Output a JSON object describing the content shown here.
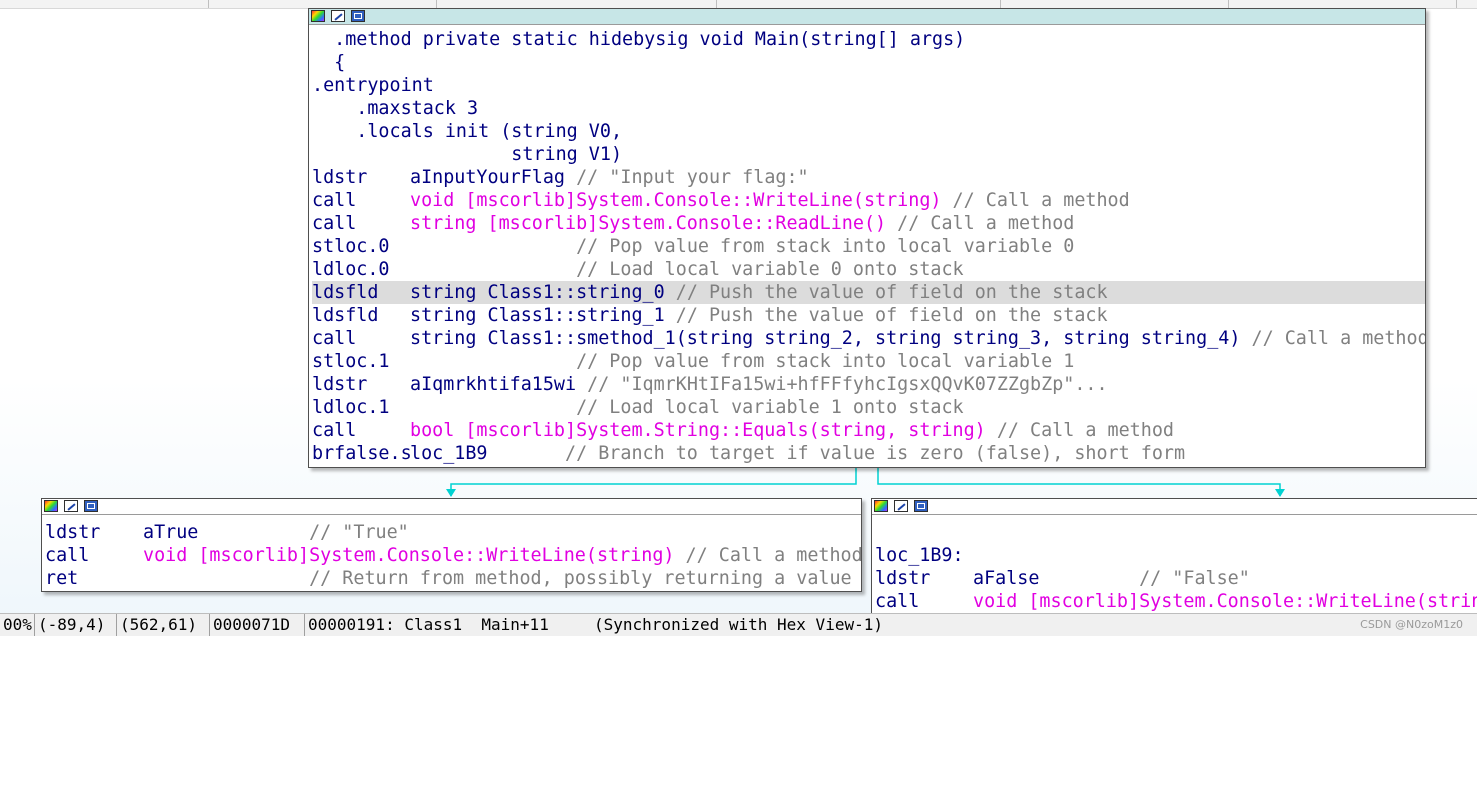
{
  "main_block": {
    "lines": [
      {
        "t": "  .method private static hidebysig void Main(string[] args)"
      },
      {
        "t": "  {"
      },
      {
        "t": ".entrypoint"
      },
      {
        "t": "    .maxstack 3"
      },
      {
        "t": "    .locals init (string V0,"
      },
      {
        "t": "                  string V1)"
      }
    ],
    "instructions": [
      {
        "mnemonic": "ldstr",
        "operand": "aInputYourFlag",
        "api": "",
        "comment": " // \"Input your flag:\"",
        "highlight": false
      },
      {
        "mnemonic": "call",
        "operand": "",
        "api": "void [mscorlib]System.Console::WriteLine(string)",
        "comment": " // Call a method",
        "highlight": false
      },
      {
        "mnemonic": "call",
        "operand": "",
        "api": "string [mscorlib]System.Console::ReadLine()",
        "comment": " // Call a method",
        "highlight": false
      },
      {
        "mnemonic": "stloc.0",
        "operand": "               ",
        "api": "",
        "comment": "// Pop value from stack into local variable 0",
        "highlight": false
      },
      {
        "mnemonic": "ldloc.0",
        "operand": "               ",
        "api": "",
        "comment": "// Load local variable 0 onto stack",
        "highlight": false
      },
      {
        "mnemonic": "ldsfld",
        "operand": "string Class1::string_0",
        "api": "",
        "comment": " // Push the value of field on the stack",
        "highlight": true
      },
      {
        "mnemonic": "ldsfld",
        "operand": "string Class1::string_1",
        "api": "",
        "comment": " // Push the value of field on the stack",
        "highlight": false
      },
      {
        "mnemonic": "call",
        "operand": "string Class1::smethod_1(string string_2, string string_3, string string_4)",
        "api": "",
        "comment": " // Call a method",
        "highlight": false
      },
      {
        "mnemonic": "stloc.1",
        "operand": "               ",
        "api": "",
        "comment": "// Pop value from stack into local variable 1",
        "highlight": false
      },
      {
        "mnemonic": "ldstr",
        "operand": "aIqmrkhtifa15wi",
        "api": "",
        "comment": " // \"IqmrKHtIFa15wi+hfFFfyhcIgsxQQvK07ZZgbZp\"...",
        "highlight": false
      },
      {
        "mnemonic": "ldloc.1",
        "operand": "               ",
        "api": "",
        "comment": "// Load local variable 1 onto stack",
        "highlight": false
      },
      {
        "mnemonic": "call",
        "operand": "",
        "api": "bool [mscorlib]System.String::Equals(string, string)",
        "comment": " // Call a method",
        "highlight": false
      },
      {
        "mnemonic": "brfalse.s",
        "operand": "loc_1B9       ",
        "api": "",
        "comment": "// Branch to target if value is zero (false), short form",
        "highlight": false
      }
    ]
  },
  "true_block": {
    "instructions": [
      {
        "mnemonic": "ldstr",
        "operand": "aTrue          ",
        "api": "",
        "comment": "// \"True\""
      },
      {
        "mnemonic": "call",
        "operand": "",
        "api": "void [mscorlib]System.Console::WriteLine(string)",
        "comment": " // Call a method"
      },
      {
        "mnemonic": "ret",
        "operand": "               ",
        "api": "",
        "comment": "// Return from method, possibly returning a value"
      }
    ]
  },
  "false_block": {
    "label": "loc_1B9:",
    "instructions": [
      {
        "mnemonic": "ldstr",
        "operand": "aFalse         ",
        "api": "",
        "comment": "// \"False\""
      },
      {
        "mnemonic": "call",
        "operand": "",
        "api": "void [mscorlib]System.Console::WriteLine(strin",
        "comment": ""
      }
    ]
  },
  "status": {
    "zoom": "00%",
    "coords1": "(-89,4)",
    "coords2": "(562,61)",
    "offset": "0000071D",
    "location": "00000191: Class1  Main+11",
    "sync": "(Synchronized with Hex View-1)"
  },
  "watermark": "CSDN @N0zoM1z0",
  "colors": {
    "mnemonic": "#000080",
    "api": "#e100e1",
    "comment": "#808080",
    "edge": "#00d2d2",
    "highlight": "#dcdcdc"
  },
  "icons": [
    "color-palette-icon",
    "edit-icon",
    "graph-view-icon"
  ]
}
